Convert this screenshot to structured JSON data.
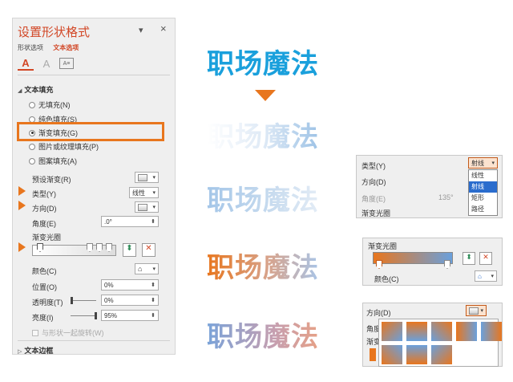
{
  "panel": {
    "title": "设置形状格式",
    "collapse_glyph": "▾",
    "close_glyph": "×",
    "tab_shape": "形状选项",
    "tab_text": "文本选项",
    "icon_text_fill": "A",
    "icon_text_outline": "A",
    "icon_text_box": "A≡",
    "section_fill": "文本填充",
    "section_fill_glyph": "◢",
    "section_border": "文本边框",
    "section_border_glyph": "▷",
    "radios": [
      {
        "label": "无填充(N)",
        "checked": false
      },
      {
        "label": "纯色填充(S)",
        "checked": false
      },
      {
        "label": "渐变填充(G)",
        "checked": true
      },
      {
        "label": "图片或纹理填充(P)",
        "checked": false
      },
      {
        "label": "图案填充(A)",
        "checked": false
      }
    ],
    "preset_label": "预设渐变(R)",
    "type_label": "类型(Y)",
    "type_value": "线性",
    "direction_label": "方向(D)",
    "angle_label": "角度(E)",
    "angle_value": ".0°",
    "stops_label": "渐变光圈",
    "color_label": "颜色(C)",
    "position_label": "位置(O)",
    "position_value": "0%",
    "transparency_label": "透明度(T)",
    "transparency_value": "0%",
    "brightness_label": "亮度(I)",
    "brightness_value": "95%",
    "rotate_label": "与形状一起旋转(W)",
    "dropdown_glyph": "▾",
    "spin_glyph": "⬍"
  },
  "samples": {
    "word": "职场魔法"
  },
  "type_box": {
    "type_label": "类型(Y)",
    "selected": "射线",
    "direction_label": "方向(D)",
    "angle_label": "角度(E)",
    "angle_value": "135°",
    "stops_label": "渐变光圈",
    "options": [
      "线性",
      "射线",
      "矩形",
      "路径"
    ],
    "highlighted": "射线",
    "dropdown_glyph": "▾"
  },
  "stops_box": {
    "title": "渐变光圈",
    "color_label": "颜色(C)"
  },
  "direction_box": {
    "direction_label": "方向(D)",
    "angle_label_partial": "角度",
    "stops_label_partial": "渐变"
  },
  "colors": {
    "accent": "#e8761e",
    "title": "#d24726",
    "blue": "#1aa0dc"
  }
}
